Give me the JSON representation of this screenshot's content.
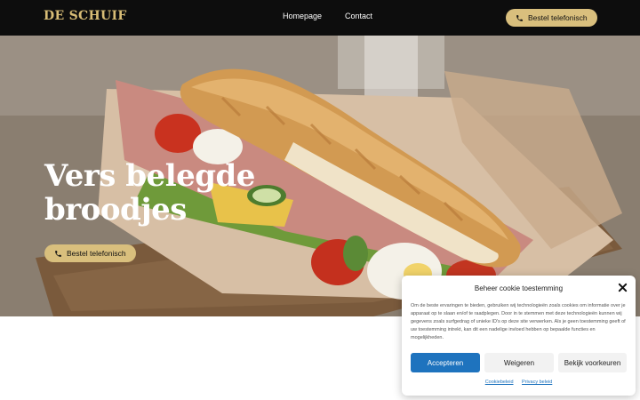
{
  "header": {
    "logo": "DE SCHUIF",
    "nav": [
      {
        "label": "Homepage"
      },
      {
        "label": "Contact"
      }
    ],
    "cta_label": "Bestel telefonisch"
  },
  "hero": {
    "title": "Vers belegde broodjes",
    "cta_label": "Bestel telefonisch"
  },
  "cookie": {
    "title": "Beheer cookie toestemming",
    "text": "Om de beste ervaringen te bieden, gebruiken wij technologieën zoals cookies om informatie over je apparaat op te slaan en/of te raadplegen. Door in te stemmen met deze technologieën kunnen wij gegevens zoals surfgedrag of unieke ID's op deze site verwerken. Als je geen toestemming geeft of uw toestemming intrekt, kan dit een nadelige invloed hebben op bepaalde functies en mogelijkheden.",
    "accept_label": "Accepteren",
    "deny_label": "Weigeren",
    "prefs_label": "Bekijk voorkeuren",
    "links": [
      "Cookiebeleid",
      "Privacy beleid"
    ]
  },
  "colors": {
    "header_bg": "#0d0d0d",
    "gold": "#d9bf7d",
    "accept_blue": "#1e73be"
  }
}
